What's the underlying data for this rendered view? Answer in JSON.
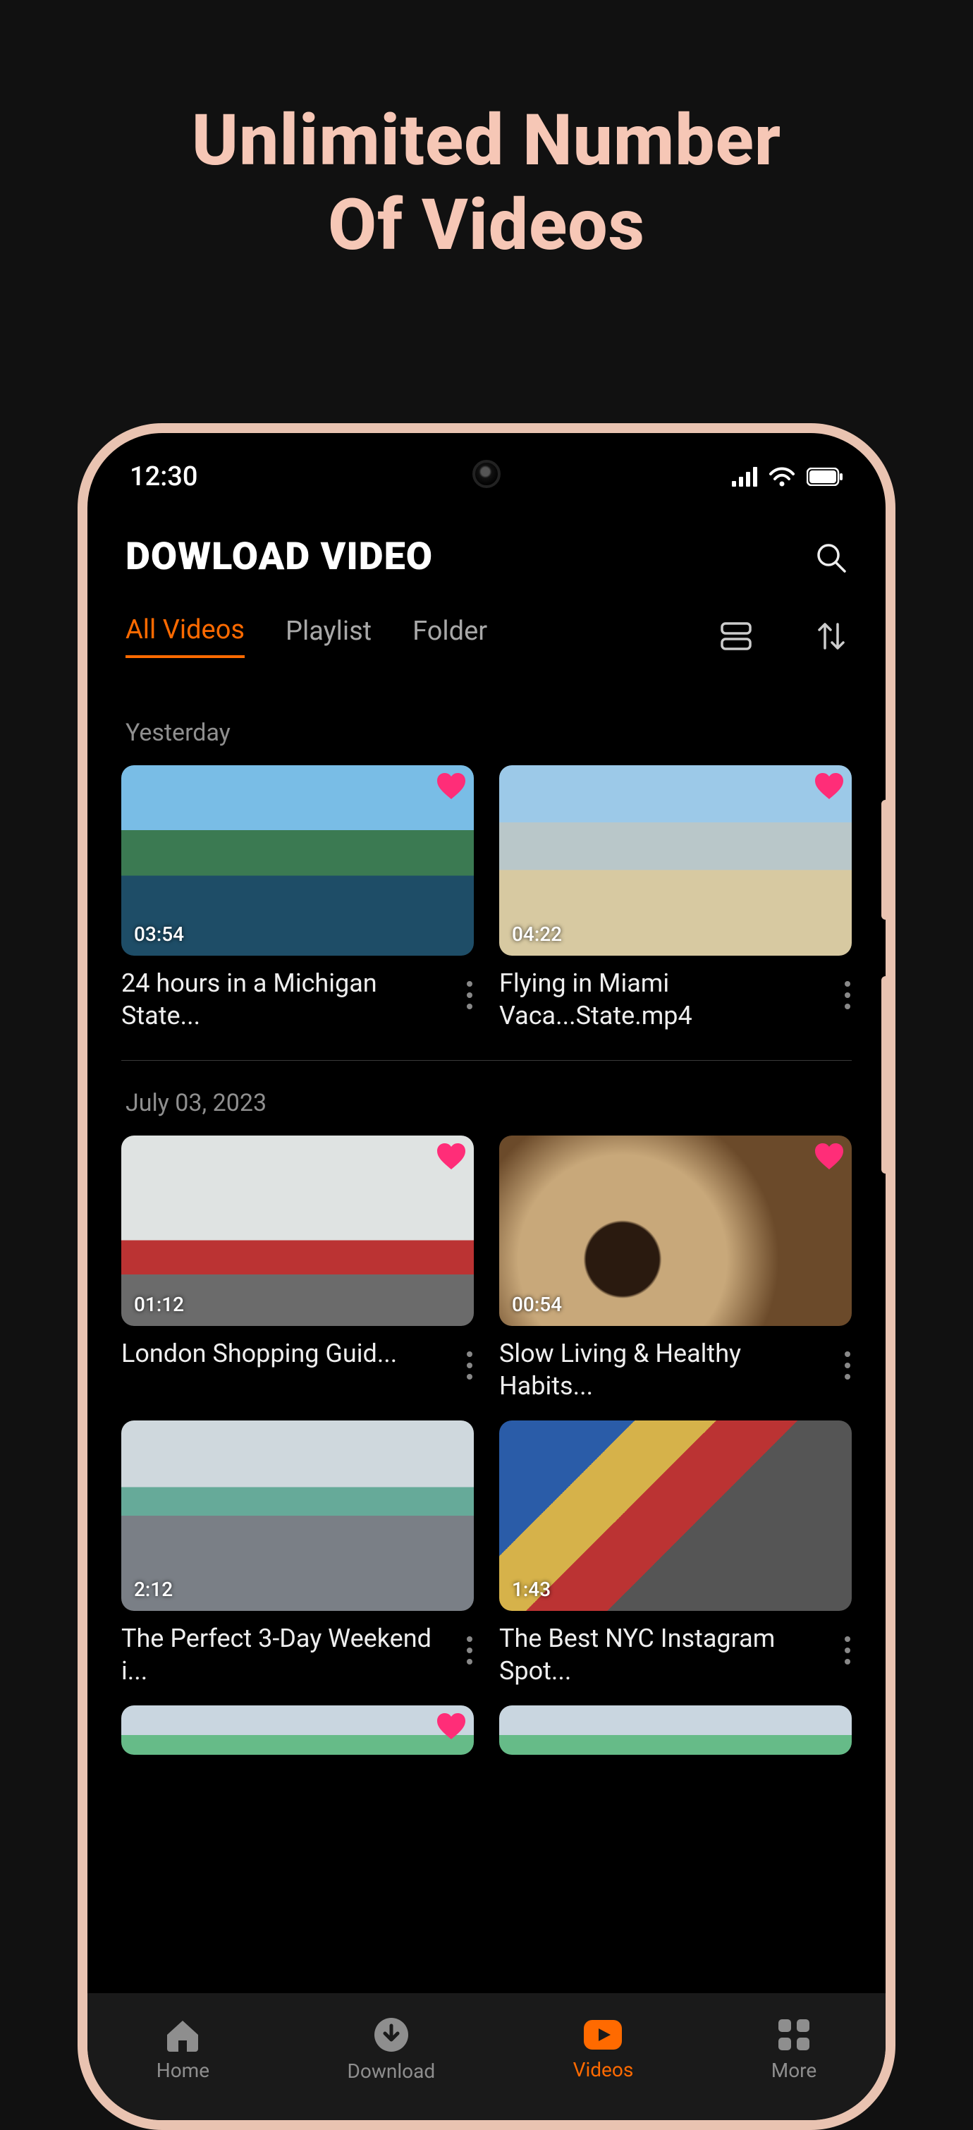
{
  "headline": {
    "line1": "Unlimited Number",
    "line2": "Of Videos"
  },
  "phone": {
    "status": {
      "time": "12:30"
    },
    "app_title": "DOWLOAD VIDEO",
    "tabs": {
      "all": "All Videos",
      "playlist": "Playlist",
      "folder": "Folder"
    },
    "sections": [
      {
        "date": "Yesterday",
        "items": [
          {
            "duration": "03:54",
            "title": "24 hours in a Michigan State..."
          },
          {
            "duration": "04:22",
            "title": "Flying in Miami Vaca...State.mp4"
          }
        ]
      },
      {
        "date": "July 03, 2023",
        "items": [
          {
            "duration": "01:12",
            "title": "London Shopping Guid..."
          },
          {
            "duration": "00:54",
            "title": "Slow Living & Healthy Habits..."
          },
          {
            "duration": "2:12",
            "title": "The Perfect 3-Day Weekend i..."
          },
          {
            "duration": "1:43",
            "title": "The Best NYC Instagram Spot..."
          }
        ]
      }
    ],
    "nav": {
      "home": "Home",
      "download": "Download",
      "videos": "Videos",
      "more": "More"
    }
  }
}
